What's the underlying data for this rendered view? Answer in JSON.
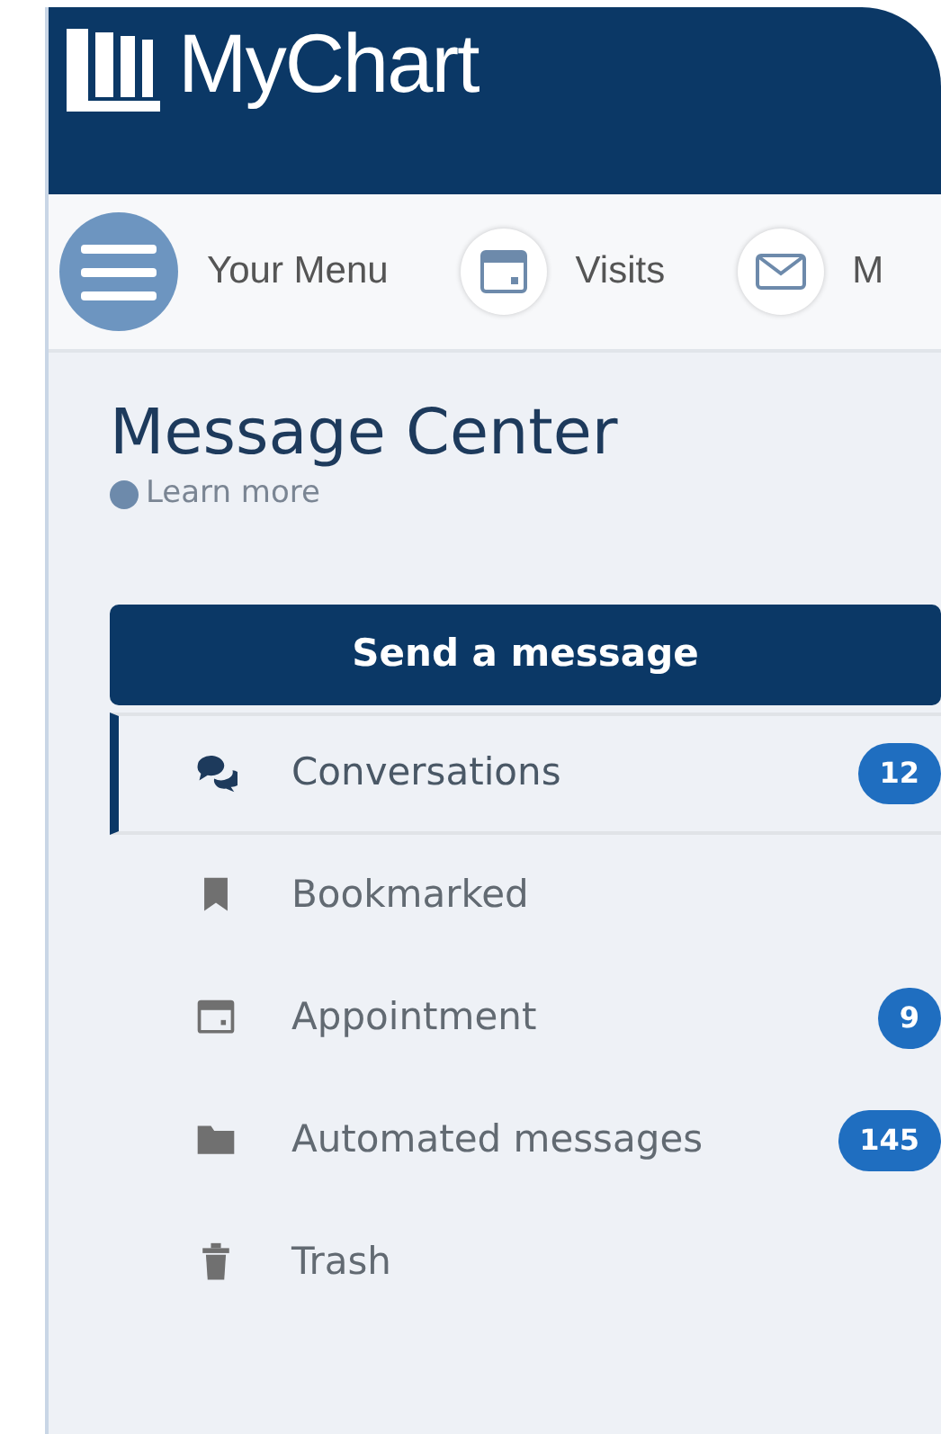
{
  "header": {
    "logo_text": "MyChart"
  },
  "toolbar": [
    {
      "label": "Your Menu"
    },
    {
      "label": "Visits"
    },
    {
      "label": "M"
    }
  ],
  "page": {
    "title": "Message Center",
    "help_link": "Learn more",
    "primary_button": "Send a message"
  },
  "folders": [
    {
      "label": "Conversations",
      "count": "12",
      "selected": true
    },
    {
      "label": "Bookmarked",
      "selected": false
    },
    {
      "label": "Appointment",
      "count": "9",
      "selected": false
    },
    {
      "label": "Automated messages",
      "count": "145",
      "selected": false
    },
    {
      "label": "Trash",
      "selected": false
    }
  ]
}
